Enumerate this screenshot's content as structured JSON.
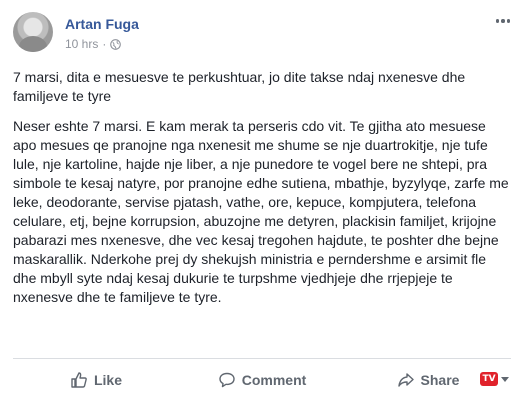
{
  "post": {
    "author": "Artan Fuga",
    "timestamp": "10 hrs",
    "visibility_icon": "globe-icon",
    "paragraphs": [
      "7 marsi, dita e mesuesve te perkushtuar, jo dite takse ndaj nxenesve dhe familjeve te tyre",
      "Neser eshte 7 marsi. E kam merak ta perseris cdo vit. Te gjitha ato mesuese apo mesues qe pranojne nga nxenesit me shume se nje duartrokitje, nje tufe lule, nje kartoline, hajde nje liber, a nje punedore te vogel bere ne shtepi, pra simbole te kesaj natyre, por pranojne edhe sutiena, mbathje, byzylyqe, zarfe me leke, deodorante, servise pjatash, vathe, ore, kepuce, kompjutera, telefona celulare, etj, bejne korrupsion, abuzojne me detyren, plackisin familjet, krijojne pabarazi mes nxenesve, dhe vec kesaj tregohen hajdute, te poshter dhe bejne maskarallik. Nderkohe prej dy shekujsh ministria e perndershme e arsimit fle dhe mbyll syte ndaj kesaj dukurie te turpshme vjedhjeje dhe rrjepjeje te nxenesve dhe te familjeve te tyre."
    ]
  },
  "actions": {
    "like_label": "Like",
    "comment_label": "Comment",
    "share_label": "Share",
    "page_badge": "TV"
  },
  "colors": {
    "author_link": "#365899",
    "meta_text": "#90949c",
    "action_text": "#606770",
    "badge_red": "#e0222b"
  }
}
